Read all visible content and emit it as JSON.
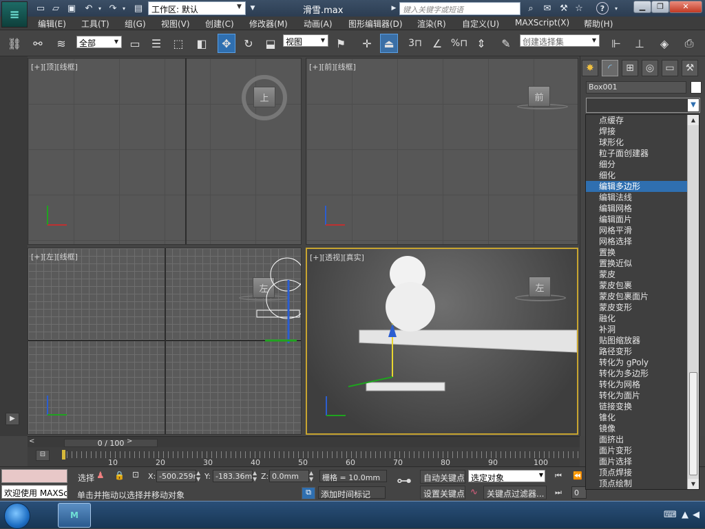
{
  "window": {
    "title": "滑雪.max",
    "workspace_label": "工作区: 默认",
    "search_placeholder": "键入关键字或短语",
    "help_label": "?"
  },
  "menu": [
    {
      "id": "edit",
      "label": "编辑(E)"
    },
    {
      "id": "tools",
      "label": "工具(T)"
    },
    {
      "id": "group",
      "label": "组(G)"
    },
    {
      "id": "views",
      "label": "视图(V)"
    },
    {
      "id": "create",
      "label": "创建(C)"
    },
    {
      "id": "modifiers",
      "label": "修改器(M)"
    },
    {
      "id": "animation",
      "label": "动画(A)"
    },
    {
      "id": "graph-editors",
      "label": "图形编辑器(D)"
    },
    {
      "id": "rendering",
      "label": "渲染(R)"
    },
    {
      "id": "customize",
      "label": "自定义(U)"
    },
    {
      "id": "maxscript",
      "label": "MAXScript(X)"
    },
    {
      "id": "help",
      "label": "帮助(H)"
    }
  ],
  "toolbar": {
    "selection_filter": "全部",
    "ref_coord": "视图",
    "snap_label": "3",
    "percent_label": "%",
    "named_selection": "创建选择集"
  },
  "viewports": {
    "top": {
      "label": "[+][顶][线框]",
      "cube": "上"
    },
    "front": {
      "label": "[+][前][线框]",
      "cube": "前"
    },
    "left": {
      "label": "[+][左][线框]",
      "cube": "左"
    },
    "perspective": {
      "label": "[+][透视][真实]",
      "cube": "左"
    }
  },
  "command_panel": {
    "object_name": "Box001",
    "object_color": "#ffffff"
  },
  "modifier_list": {
    "selected_index": 6,
    "items": [
      "点缓存",
      "焊接",
      "球形化",
      "粒子面创建器",
      "细分",
      "细化",
      "编辑多边形",
      "编辑法线",
      "编辑网格",
      "编辑面片",
      "网格平滑",
      "网格选择",
      "置换",
      "置换近似",
      "蒙皮",
      "蒙皮包裹",
      "蒙皮包裹面片",
      "蒙皮变形",
      "融化",
      "补洞",
      "贴图缩放器",
      "路径变形",
      "转化为 gPoly",
      "转化为多边形",
      "转化为网格",
      "转化为面片",
      "链接变换",
      "锥化",
      "镜像",
      "面挤出",
      "面片变形",
      "面片选择",
      "顶点焊接",
      "顶点绘制"
    ]
  },
  "timeline": {
    "frame_display": "0 / 100",
    "ticks": [
      "10",
      "20",
      "30",
      "40",
      "50",
      "60",
      "70",
      "80",
      "90",
      "100"
    ]
  },
  "status": {
    "welcome": "欢迎使用 MAXSc",
    "select_label": "选择",
    "x_label": "X:",
    "x_value": "-500.259m",
    "y_label": "Y:",
    "y_value": "-183.36mm",
    "z_label": "Z:",
    "z_value": "0.0mm",
    "grid": "栅格 = 10.0mm",
    "prompt": "单击并拖动以选择并移动对象",
    "add_time_tag": "添加时间标记",
    "auto_key": "自动关键点",
    "set_key": "设置关键点",
    "key_mode": "选定对象",
    "key_filters": "关键点过滤器...",
    "frame_value": "0"
  },
  "colors": {
    "accent": "#2f6fb0",
    "viewport_active_border": "#c8a530"
  }
}
